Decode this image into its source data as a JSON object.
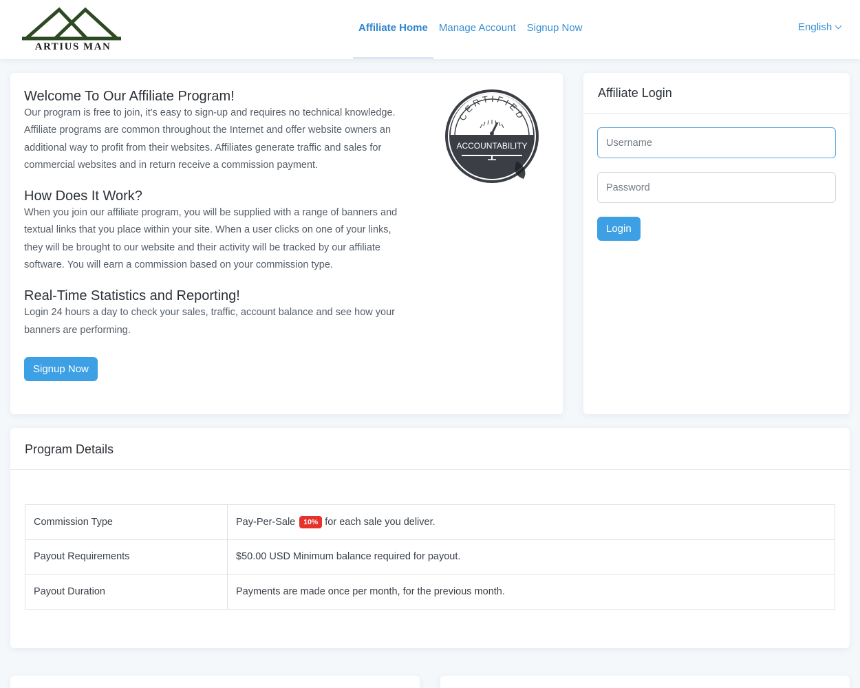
{
  "brand": {
    "logo_text": "ARTIUS MAN"
  },
  "nav": {
    "items": [
      {
        "label": "Affiliate Home",
        "active": true
      },
      {
        "label": "Manage Account",
        "active": false
      },
      {
        "label": "Signup Now",
        "active": false
      }
    ],
    "language": "English"
  },
  "welcome": {
    "sections": [
      {
        "title": "Welcome To Our Affiliate Program!",
        "body": "Our program is free to join, it's easy to sign-up and requires no technical knowledge. Affiliate programs are common throughout the Internet and offer website owners an additional way to profit from their websites. Affiliates generate traffic and sales for commercial websites and in return receive a commission payment."
      },
      {
        "title": "How Does It Work?",
        "body": "When you join our affiliate program, you will be supplied with a range of banners and textual links that you place within your site. When a user clicks on one of your links, they will be brought to our website and their activity will be tracked by our affiliate software. You will earn a commission based on your commission type."
      },
      {
        "title": "Real-Time Statistics and Reporting!",
        "body": "Login 24 hours a day to check your sales, traffic, account balance and see how your banners are performing."
      }
    ],
    "signup_label": "Signup Now",
    "badge": {
      "arc_text": "CERTIFIED",
      "label": "ACCOUNTABILITY"
    }
  },
  "login": {
    "title": "Affiliate Login",
    "username_placeholder": "Username",
    "password_placeholder": "Password",
    "button_label": "Login"
  },
  "details": {
    "title": "Program Details",
    "rows": [
      {
        "key": "Commission Type",
        "value_pre": "Pay-Per-Sale",
        "badge": "10%",
        "value_post": "for each sale you deliver."
      },
      {
        "key": "Payout Requirements",
        "value_pre": "$50.00 USD Minimum balance required for payout.",
        "badge": "",
        "value_post": ""
      },
      {
        "key": "Payout Duration",
        "value_pre": "Payments are made once per month, for the previous month.",
        "badge": "",
        "value_post": ""
      }
    ]
  },
  "colors": {
    "accent": "#3ea0e4",
    "link": "#3a8fd1",
    "badge_red": "#e5322d",
    "logo_green": "#2e4a22"
  }
}
